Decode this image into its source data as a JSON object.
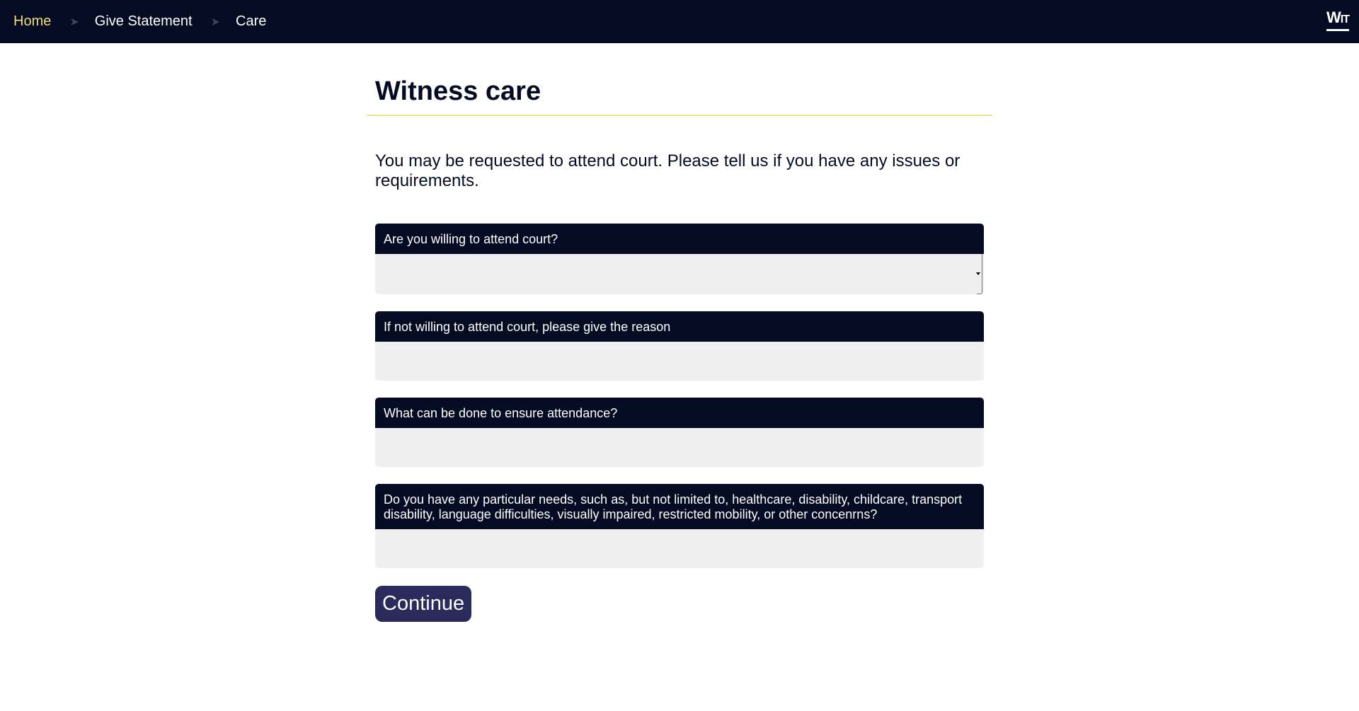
{
  "breadcrumb": {
    "items": [
      {
        "label": "Home"
      },
      {
        "label": "Give Statement"
      },
      {
        "label": "Care"
      }
    ],
    "separator": "➤"
  },
  "logo": {
    "text_big": "W",
    "text_small": "IT"
  },
  "page": {
    "title": "Witness care",
    "intro": "You may be requested to attend court. Please tell us if you have any issues or requirements."
  },
  "form": {
    "fields": [
      {
        "label": "Are you willing to attend court?",
        "type": "select",
        "value": ""
      },
      {
        "label": "If not willing to attend court, please give the reason",
        "type": "text",
        "value": ""
      },
      {
        "label": "What can be done to ensure attendance?",
        "type": "text",
        "value": ""
      },
      {
        "label": "Do you have any particular needs, such as, but not limited to, healthcare, disability, childcare, transport disability, language difficulties, visually impaired, restricted mobility, or other concenrns?",
        "type": "text",
        "value": ""
      }
    ],
    "continue_label": "Continue"
  },
  "colors": {
    "navbar": "#050b22",
    "home_link": "#f0dc7c",
    "title_rule": "#f2e29a",
    "input_bg": "#efefef",
    "button": "#2a2a5c"
  }
}
